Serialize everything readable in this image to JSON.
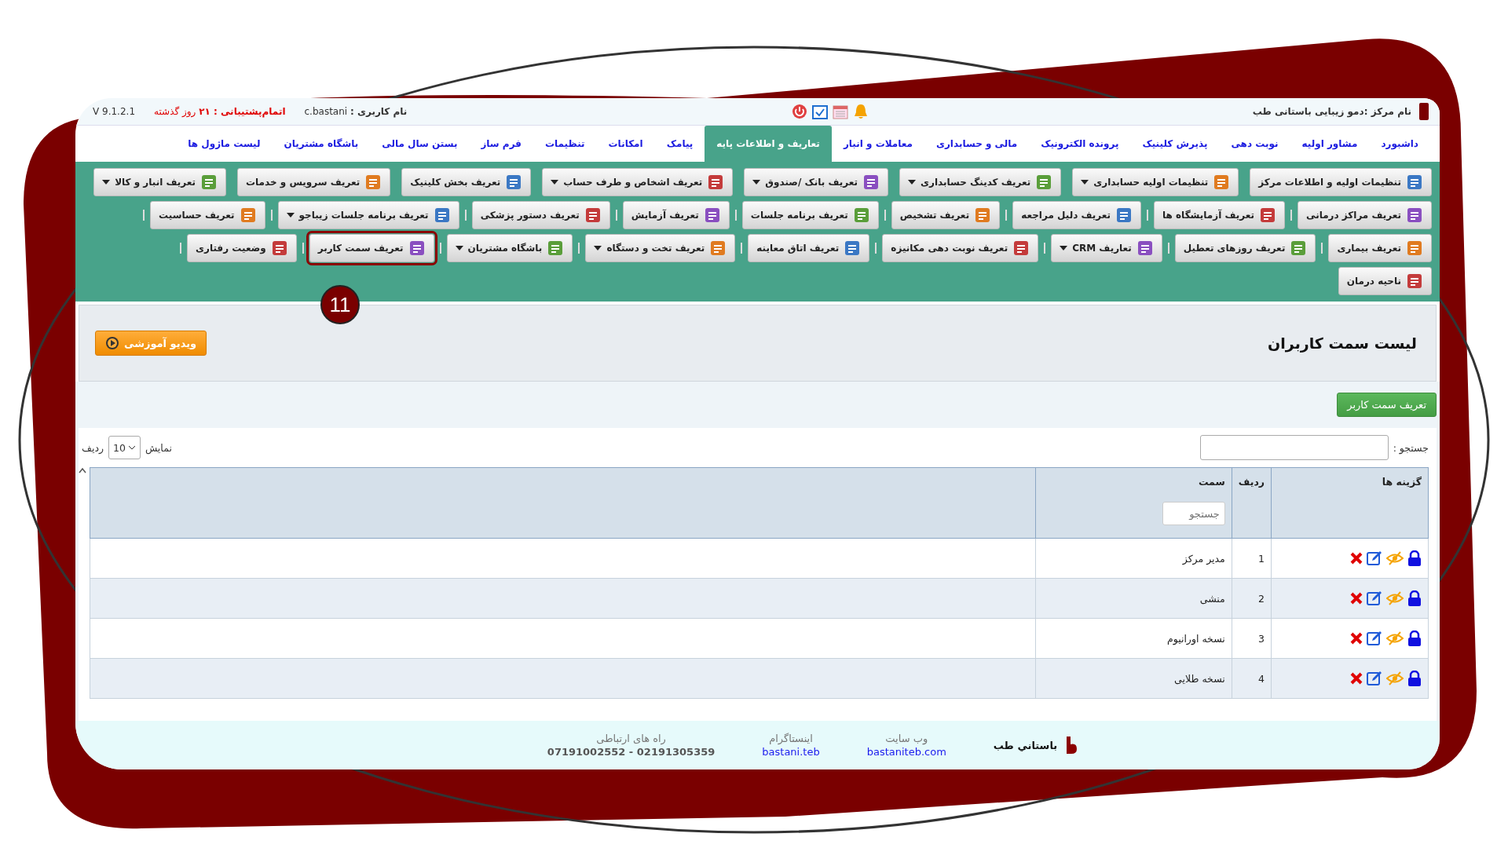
{
  "top_bar": {
    "center_name": "نام مرکز :دمو زیبایی باستانی طب",
    "user": "**نام کاربری :** c.bastani",
    "support": "**اتمام‌پشتیبانی : ۲۱** روز گذشته",
    "version": "V 9.1.2.1"
  },
  "nav_tabs": [
    {
      "label": "داشبورد",
      "selected": false
    },
    {
      "label": "مشاور اولیه",
      "selected": false
    },
    {
      "label": "نوبت دهی",
      "selected": false
    },
    {
      "label": "پذیرش کلینیک",
      "selected": false
    },
    {
      "label": "پرونده الکترونیک",
      "selected": false
    },
    {
      "label": "مالی و حسابداری",
      "selected": false
    },
    {
      "label": "معاملات و انبار",
      "selected": false
    },
    {
      "label": "تعاریف و اطلاعات پایه",
      "selected": true
    },
    {
      "label": "پیامک",
      "selected": false
    },
    {
      "label": "امکانات",
      "selected": false
    },
    {
      "label": "تنظیمات",
      "selected": false
    },
    {
      "label": "فرم ساز",
      "selected": false
    },
    {
      "label": "بستن سال مالی",
      "selected": false
    },
    {
      "label": "باشگاه مشتریان",
      "selected": false
    },
    {
      "label": "لیست ماژول ها",
      "selected": false
    }
  ],
  "toolbar_rows": [
    [
      {
        "label": "تنظیمات اولیه و اطلاعات مرکز",
        "dropdown": false,
        "highlighted": false
      },
      {
        "label": "تنظیمات اولیه حسابداری",
        "dropdown": true,
        "highlighted": false
      },
      {
        "label": "تعریف کدینگ حسابداری",
        "dropdown": true,
        "highlighted": false
      },
      {
        "label": "تعریف بانک /صندوق",
        "dropdown": true,
        "highlighted": false
      },
      {
        "label": "تعریف اشخاص و طرف حساب",
        "dropdown": true,
        "highlighted": false
      },
      {
        "label": "تعریف بخش کلینیک",
        "dropdown": false,
        "highlighted": false
      },
      {
        "label": "تعریف سرویس و خدمات",
        "dropdown": false,
        "highlighted": false
      },
      {
        "label": "تعریف انبار و کالا",
        "dropdown": true,
        "highlighted": false
      }
    ],
    [
      {
        "label": "تعریف مراکز درمانی",
        "dropdown": false,
        "highlighted": false
      },
      {
        "label": "تعریف آزمایشگاه ها",
        "dropdown": false,
        "highlighted": false
      },
      {
        "label": "تعریف دلیل مراجعه",
        "dropdown": false,
        "highlighted": false
      },
      {
        "label": "تعریف تشخیص",
        "dropdown": false,
        "highlighted": false
      },
      {
        "label": "تعریف برنامه جلسات",
        "dropdown": false,
        "highlighted": false
      },
      {
        "label": "تعریف آزمایش",
        "dropdown": false,
        "highlighted": false
      },
      {
        "label": "تعریف دستور پزشکی",
        "dropdown": false,
        "highlighted": false
      },
      {
        "label": "تعریف برنامه جلسات زیباجو",
        "dropdown": true,
        "highlighted": false
      },
      {
        "label": "تعریف حساسیت",
        "dropdown": false,
        "highlighted": false
      }
    ],
    [
      {
        "label": "تعریف بیماری",
        "dropdown": false,
        "highlighted": false
      },
      {
        "label": "تعریف روزهای تعطیل",
        "dropdown": false,
        "highlighted": false
      },
      {
        "label": "تعاریف CRM",
        "dropdown": true,
        "highlighted": false
      },
      {
        "label": "تعریف نوبت دهی مکانیزه",
        "dropdown": false,
        "highlighted": false
      },
      {
        "label": "تعریف اتاق معاینه",
        "dropdown": false,
        "highlighted": false
      },
      {
        "label": "تعریف تخت و دستگاه",
        "dropdown": true,
        "highlighted": false
      },
      {
        "label": "باشگاه مشتریان",
        "dropdown": true,
        "highlighted": false
      },
      {
        "label": "تعریف سمت کاربر",
        "dropdown": false,
        "highlighted": true
      },
      {
        "label": "وضعیت رفتاری",
        "dropdown": false,
        "highlighted": false
      }
    ],
    [
      {
        "label": "ناحیه درمان",
        "dropdown": false,
        "highlighted": false
      }
    ]
  ],
  "callout": {
    "text": "11"
  },
  "page_header": {
    "title": "لیست سمت کاربران",
    "video_button": "ویدیو آموزشی"
  },
  "add_button": "تعریف سمت کاربر",
  "table_controls": {
    "search_label": "جستجو :",
    "show_label": "نمایش",
    "page_size": "10",
    "rows_label": "ردیف"
  },
  "table": {
    "columns": [
      "گزینه ها",
      "ردیف",
      "سمت"
    ],
    "filter_placeholder": "جستجو",
    "rows": [
      {
        "index": "1",
        "title": "مدیر مرکز"
      },
      {
        "index": "2",
        "title": "منشی"
      },
      {
        "index": "3",
        "title": "نسخه اورانیوم"
      },
      {
        "index": "4",
        "title": "نسخه طلایی"
      }
    ]
  },
  "footer": {
    "brand": "باستاني طب",
    "links": [
      {
        "label": "وب سایت",
        "value": "bastaniteb.com",
        "kind": "link"
      },
      {
        "label": "اینستاگرام",
        "value": "bastani.teb",
        "kind": "link"
      },
      {
        "label": "راه های ارتباطی",
        "value": "07191002552 - 02191305359",
        "kind": "phone"
      }
    ]
  }
}
